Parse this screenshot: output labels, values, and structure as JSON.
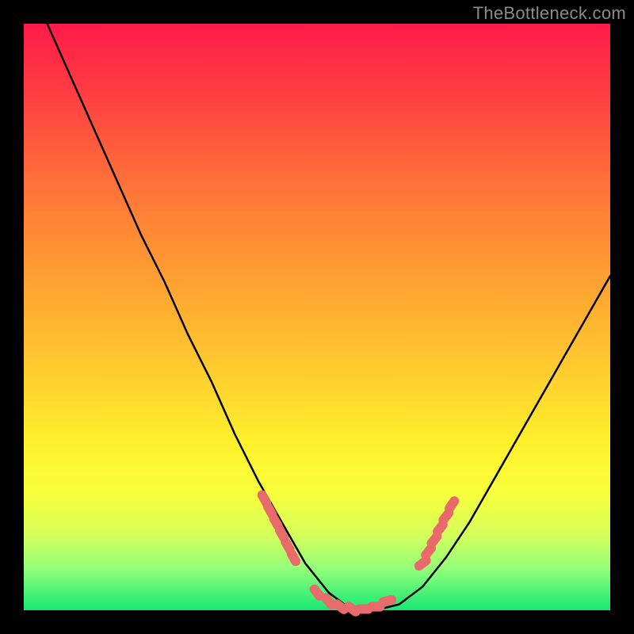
{
  "watermark": "TheBottleneck.com",
  "chart_data": {
    "type": "line",
    "title": "",
    "xlabel": "",
    "ylabel": "",
    "xlim": [
      0,
      100
    ],
    "ylim": [
      0,
      100
    ],
    "grid": false,
    "legend": false,
    "series": [
      {
        "name": "bottleneck-curve",
        "x": [
          4,
          8,
          12,
          16,
          20,
          24,
          28,
          32,
          36,
          40,
          44,
          48,
          52,
          56,
          60,
          64,
          68,
          72,
          76,
          80,
          84,
          88,
          92,
          96,
          100
        ],
        "y": [
          100,
          91,
          82,
          73,
          64,
          56,
          47,
          39,
          30,
          22,
          15,
          8,
          3,
          0,
          0,
          1,
          4,
          9,
          15,
          22,
          29,
          36,
          43,
          50,
          57
        ],
        "color": "#000000"
      }
    ],
    "highlights": {
      "name": "sweet-spot-markers",
      "color": "#e86a6a",
      "points": [
        {
          "x": 41,
          "y": 19
        },
        {
          "x": 42,
          "y": 17
        },
        {
          "x": 43,
          "y": 15
        },
        {
          "x": 44,
          "y": 13
        },
        {
          "x": 45,
          "y": 11
        },
        {
          "x": 46,
          "y": 9
        },
        {
          "x": 50,
          "y": 3
        },
        {
          "x": 52,
          "y": 1.5
        },
        {
          "x": 54,
          "y": 0.6
        },
        {
          "x": 56,
          "y": 0.2
        },
        {
          "x": 58,
          "y": 0.2
        },
        {
          "x": 60,
          "y": 0.6
        },
        {
          "x": 62,
          "y": 1.6
        },
        {
          "x": 68,
          "y": 8
        },
        {
          "x": 69,
          "y": 10
        },
        {
          "x": 70,
          "y": 12
        },
        {
          "x": 71,
          "y": 14
        },
        {
          "x": 72,
          "y": 16
        },
        {
          "x": 73,
          "y": 18
        }
      ]
    }
  },
  "colors": {
    "background": "#000000",
    "gradient_top": "#ff1a49",
    "gradient_mid": "#ffd42e",
    "gradient_bottom": "#17e874",
    "curve": "#000000",
    "markers": "#e86a6a",
    "watermark": "#8a8a8a"
  }
}
